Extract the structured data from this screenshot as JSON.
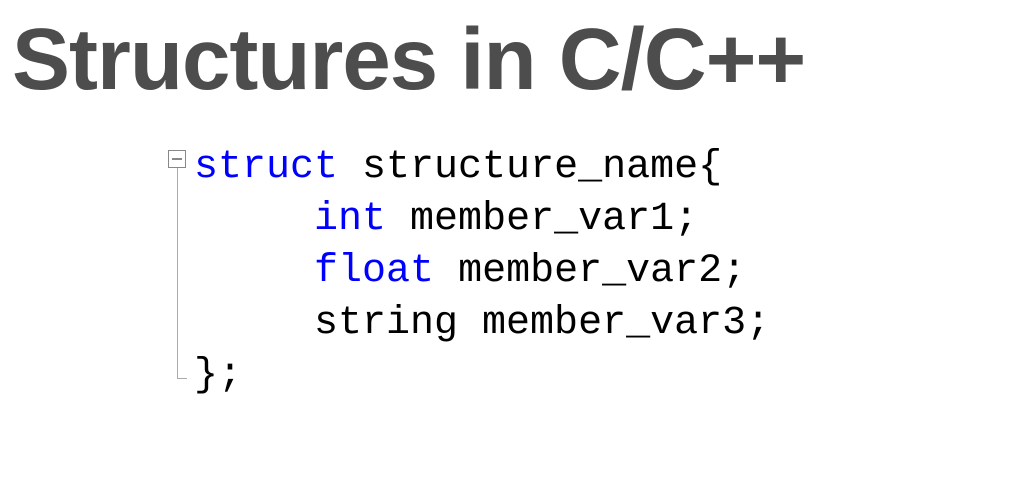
{
  "title": "Structures in C/C++",
  "code": {
    "keyword_struct": "struct",
    "struct_name": " structure_name{",
    "keyword_int": "int",
    "member1": " member_var1;",
    "keyword_float": "float",
    "member2": " member_var2;",
    "line4": "     string member_var3;",
    "closing": "};",
    "indent": "     "
  }
}
